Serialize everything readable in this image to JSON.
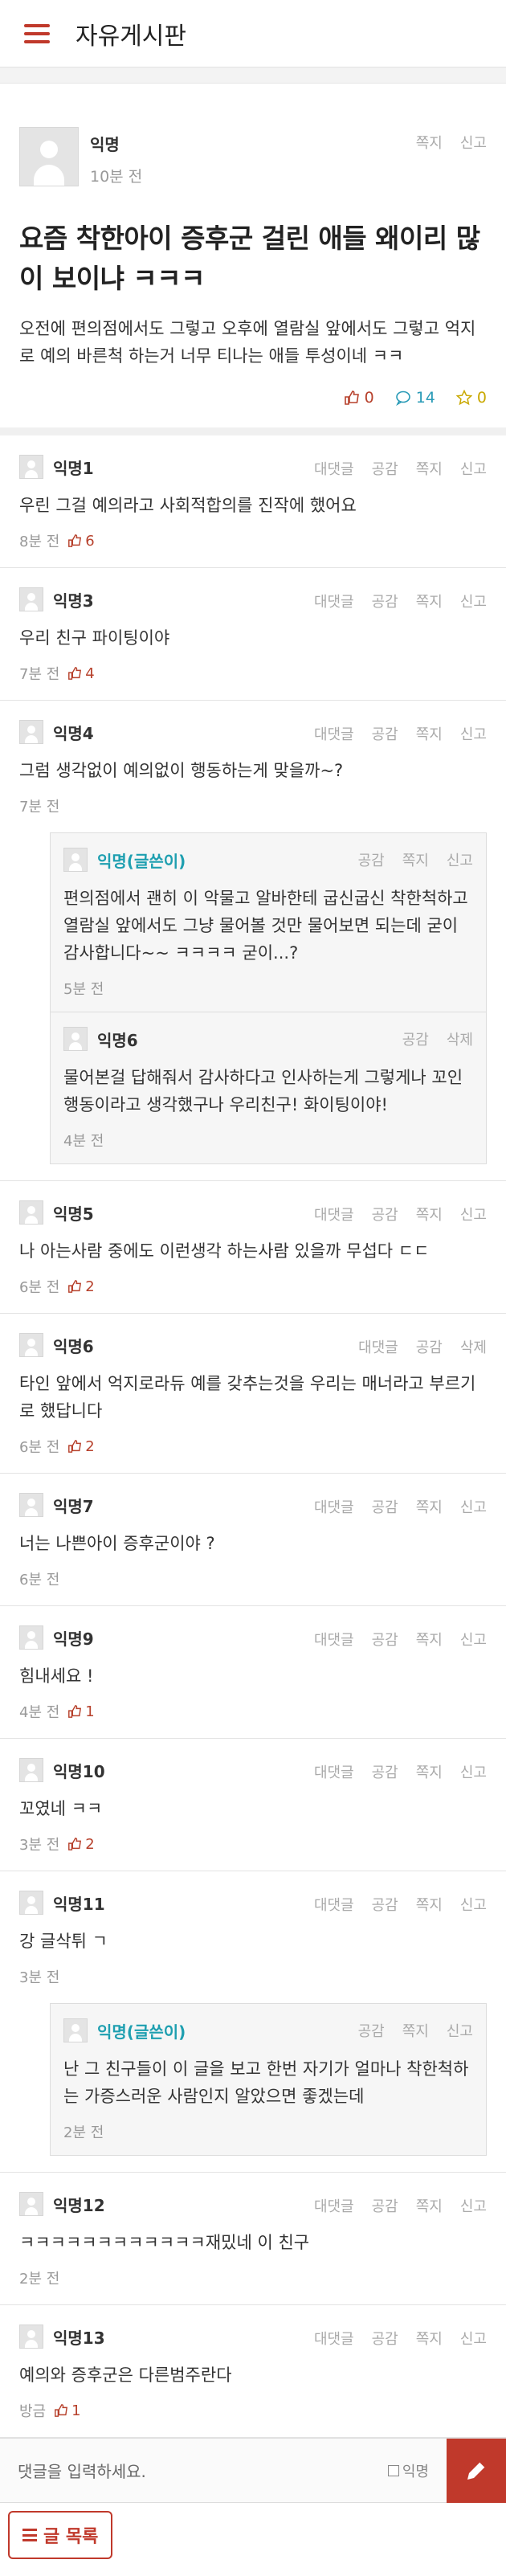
{
  "header": {
    "title": "자유게시판"
  },
  "post": {
    "author": "익명",
    "time": "10분 전",
    "links": [
      "쪽지",
      "신고"
    ],
    "title": "요즘 착한아이 증후군 걸린 애들 왜이리 많이 보이냐 ㅋㅋㅋ",
    "body": "오전에 편의점에서도 그렇고 오후에 열람실 앞에서도 그렇고 억지로 예의 바른척 하는거 너무 티나는 애들 투성이네 ㅋㅋ",
    "likes": "0",
    "comments": "14",
    "scraps": "0"
  },
  "comments": [
    {
      "name": "익명1",
      "links": [
        "대댓글",
        "공감",
        "쪽지",
        "신고"
      ],
      "text": "우린 그걸 예의라고 사회적합의를 진작에 했어요",
      "time": "8분 전",
      "likes": "6"
    },
    {
      "name": "익명3",
      "links": [
        "대댓글",
        "공감",
        "쪽지",
        "신고"
      ],
      "text": "우리 친구 파이팅이야",
      "time": "7분 전",
      "likes": "4"
    },
    {
      "name": "익명4",
      "links": [
        "대댓글",
        "공감",
        "쪽지",
        "신고"
      ],
      "text": "그럼 생각없이 예의없이 행동하는게 맞을까~?",
      "time": "7분 전",
      "likes": "",
      "replies": [
        {
          "name": "익명(글쓴이)",
          "op": true,
          "links": [
            "공감",
            "쪽지",
            "신고"
          ],
          "text": "편의점에서 괜히 이 악물고 알바한테 굽신굽신 착한척하고 열람실 앞에서도 그냥 물어볼 것만 물어보면 되는데 굳이 감사합니다~~ ㅋㅋㅋㅋ 굳이...?",
          "time": "5분 전"
        },
        {
          "name": "익명6",
          "op": false,
          "links": [
            "공감",
            "삭제"
          ],
          "text": "물어본걸 답해줘서 감사하다고 인사하는게 그렇게나 꼬인행동이라고 생각했구나 우리친구! 화이팅이야!",
          "time": "4분 전"
        }
      ]
    },
    {
      "name": "익명5",
      "links": [
        "대댓글",
        "공감",
        "쪽지",
        "신고"
      ],
      "text": "나 아는사람 중에도 이런생각 하는사람 있을까 무섭다 ㄷㄷ",
      "time": "6분 전",
      "likes": "2"
    },
    {
      "name": "익명6",
      "links": [
        "대댓글",
        "공감",
        "삭제"
      ],
      "text": "타인 앞에서 억지로라듀 예를 갖추는것을 우리는 매너라고 부르기로 했답니다",
      "time": "6분 전",
      "likes": "2"
    },
    {
      "name": "익명7",
      "links": [
        "대댓글",
        "공감",
        "쪽지",
        "신고"
      ],
      "text": "너는 나쁜아이 증후군이야 ?",
      "time": "6분 전",
      "likes": ""
    },
    {
      "name": "익명9",
      "links": [
        "대댓글",
        "공감",
        "쪽지",
        "신고"
      ],
      "text": "힘내세요 !",
      "time": "4분 전",
      "likes": "1"
    },
    {
      "name": "익명10",
      "links": [
        "대댓글",
        "공감",
        "쪽지",
        "신고"
      ],
      "text": "꼬였네 ㅋㅋ",
      "time": "3분 전",
      "likes": "2"
    },
    {
      "name": "익명11",
      "links": [
        "대댓글",
        "공감",
        "쪽지",
        "신고"
      ],
      "text": "강 글삭튀 ㄱ",
      "time": "3분 전",
      "likes": "",
      "replies": [
        {
          "name": "익명(글쓴이)",
          "op": true,
          "links": [
            "공감",
            "쪽지",
            "신고"
          ],
          "text": "난 그 친구들이 이 글을 보고 한번 자기가 얼마나 착한척하는 가증스러운 사람인지 알았으면 좋겠는데",
          "time": "2분 전"
        }
      ]
    },
    {
      "name": "익명12",
      "links": [
        "대댓글",
        "공감",
        "쪽지",
        "신고"
      ],
      "text": "ㅋㅋㅋㅋㅋㅋㅋㅋㅋㅋㅋㅋ재밌네 이 친구",
      "time": "2분 전",
      "likes": ""
    },
    {
      "name": "익명13",
      "links": [
        "대댓글",
        "공감",
        "쪽지",
        "신고"
      ],
      "text": "예의와 증후군은 다른범주란다",
      "time": "방금",
      "likes": "1"
    }
  ],
  "comment_bar": {
    "placeholder": "댓글을 입력하세요.",
    "anon_label": "익명"
  },
  "footer": {
    "list_button": "글 목록"
  },
  "colors": {
    "accent": "#c0392b",
    "op_name": "#1e9fb0"
  }
}
